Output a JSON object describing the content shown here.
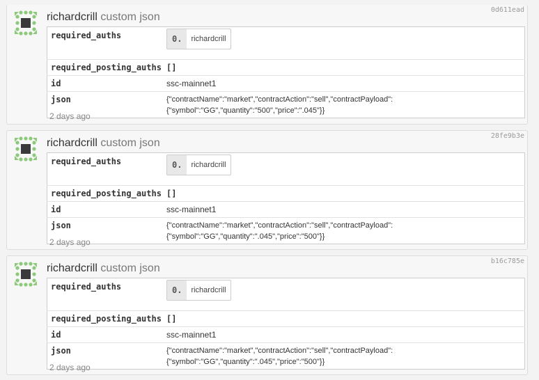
{
  "ops": [
    {
      "author": "richardcrill",
      "type": "custom json",
      "hash": "0d611ead",
      "keys": {
        "required_auths": "required_auths",
        "required_posting_auths": "required_posting_auths",
        "id": "id",
        "json": "json"
      },
      "required_auths": [
        {
          "index": "0.",
          "name": "richardcrill"
        }
      ],
      "required_posting_auths": "[]",
      "id": "ssc-mainnet1",
      "json_line1": "{\"contractName\":\"market\",\"contractAction\":\"sell\",\"contractPayload\":",
      "json_line2": "{\"symbol\":\"GG\",\"quantity\":\"500\",\"price\":\".045\"}}",
      "time": "2 days ago"
    },
    {
      "author": "richardcrill",
      "type": "custom json",
      "hash": "28fe9b3e",
      "keys": {
        "required_auths": "required_auths",
        "required_posting_auths": "required_posting_auths",
        "id": "id",
        "json": "json"
      },
      "required_auths": [
        {
          "index": "0.",
          "name": "richardcrill"
        }
      ],
      "required_posting_auths": "[]",
      "id": "ssc-mainnet1",
      "json_line1": "{\"contractName\":\"market\",\"contractAction\":\"sell\",\"contractPayload\":",
      "json_line2": "{\"symbol\":\"GG\",\"quantity\":\".045\",\"price\":\"500\"}}",
      "time": "2 days ago"
    },
    {
      "author": "richardcrill",
      "type": "custom json",
      "hash": "b16c785e",
      "keys": {
        "required_auths": "required_auths",
        "required_posting_auths": "required_posting_auths",
        "id": "id",
        "json": "json"
      },
      "required_auths": [
        {
          "index": "0.",
          "name": "richardcrill"
        }
      ],
      "required_posting_auths": "[]",
      "id": "ssc-mainnet1",
      "json_line1": "{\"contractName\":\"market\",\"contractAction\":\"sell\",\"contractPayload\":",
      "json_line2": "{\"symbol\":\"GG\",\"quantity\":\".045\",\"price\":\"500\"}}",
      "time": "2 days ago"
    }
  ],
  "colors": {
    "avatar_green": "#8cc97a",
    "avatar_square": "#3a3a3a"
  },
  "icons": {
    "avatar": "identicon-avatar"
  }
}
